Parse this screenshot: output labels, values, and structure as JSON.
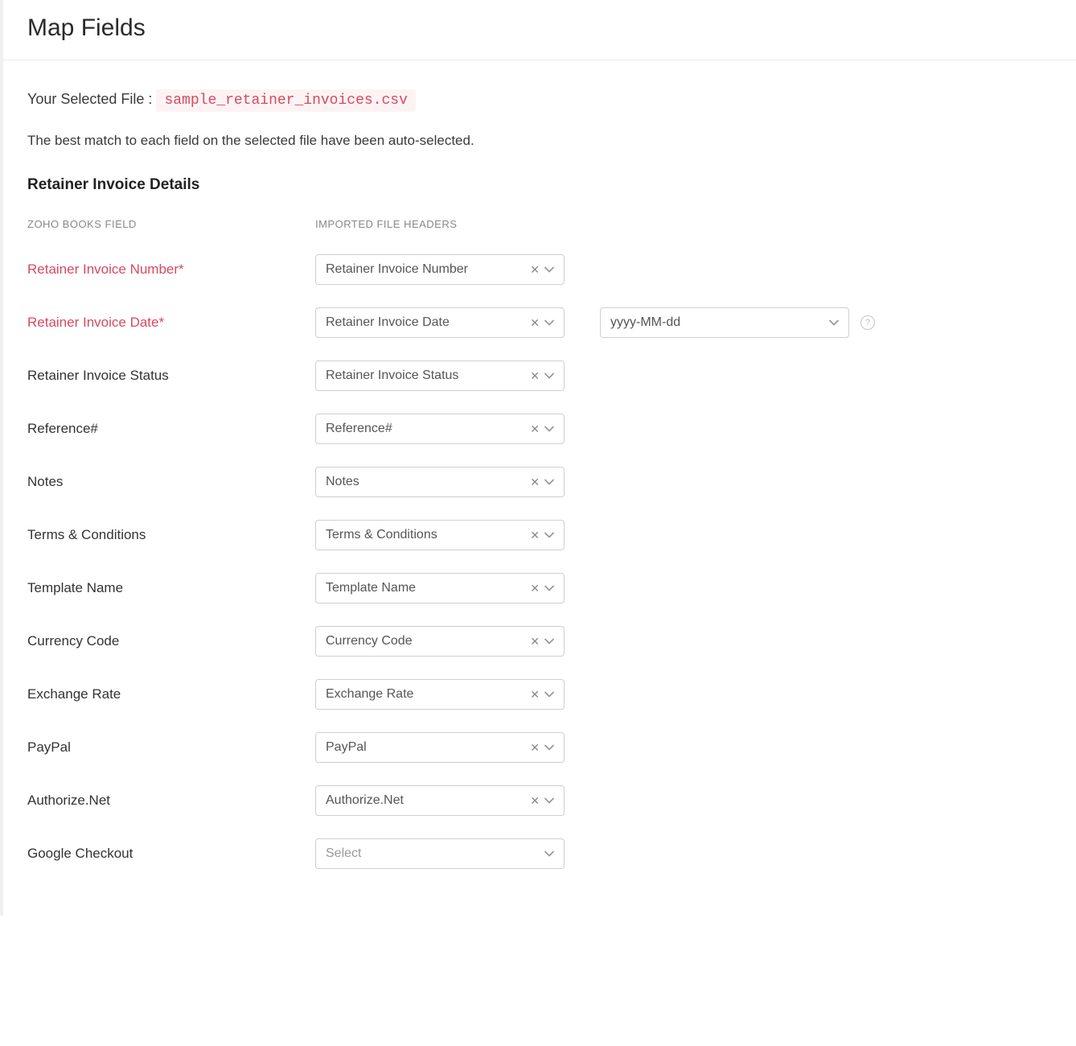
{
  "page_title": "Map Fields",
  "selected_file_label": "Your Selected File :",
  "selected_file_name": "sample_retainer_invoices.csv",
  "hint": "The best match to each field on the selected file have been auto-selected.",
  "section_title": "Retainer Invoice Details",
  "column_headers": {
    "left": "ZOHO BOOKS FIELD",
    "mid": "IMPORTED FILE HEADERS"
  },
  "date_format_value": "yyyy-MM-dd",
  "select_placeholder": "Select",
  "help_glyph": "?",
  "fields": [
    {
      "label": "Retainer Invoice Number*",
      "required": true,
      "value": "Retainer Invoice Number",
      "has_value": true,
      "has_date_format": false
    },
    {
      "label": "Retainer Invoice Date*",
      "required": true,
      "value": "Retainer Invoice Date",
      "has_value": true,
      "has_date_format": true
    },
    {
      "label": "Retainer Invoice Status",
      "required": false,
      "value": "Retainer Invoice Status",
      "has_value": true,
      "has_date_format": false
    },
    {
      "label": "Reference#",
      "required": false,
      "value": "Reference#",
      "has_value": true,
      "has_date_format": false
    },
    {
      "label": "Notes",
      "required": false,
      "value": "Notes",
      "has_value": true,
      "has_date_format": false
    },
    {
      "label": "Terms & Conditions",
      "required": false,
      "value": "Terms & Conditions",
      "has_value": true,
      "has_date_format": false
    },
    {
      "label": "Template Name",
      "required": false,
      "value": "Template Name",
      "has_value": true,
      "has_date_format": false
    },
    {
      "label": "Currency Code",
      "required": false,
      "value": "Currency Code",
      "has_value": true,
      "has_date_format": false
    },
    {
      "label": "Exchange Rate",
      "required": false,
      "value": "Exchange Rate",
      "has_value": true,
      "has_date_format": false
    },
    {
      "label": "PayPal",
      "required": false,
      "value": "PayPal",
      "has_value": true,
      "has_date_format": false
    },
    {
      "label": "Authorize.Net",
      "required": false,
      "value": "Authorize.Net",
      "has_value": true,
      "has_date_format": false
    },
    {
      "label": "Google Checkout",
      "required": false,
      "value": "",
      "has_value": false,
      "has_date_format": false
    }
  ]
}
